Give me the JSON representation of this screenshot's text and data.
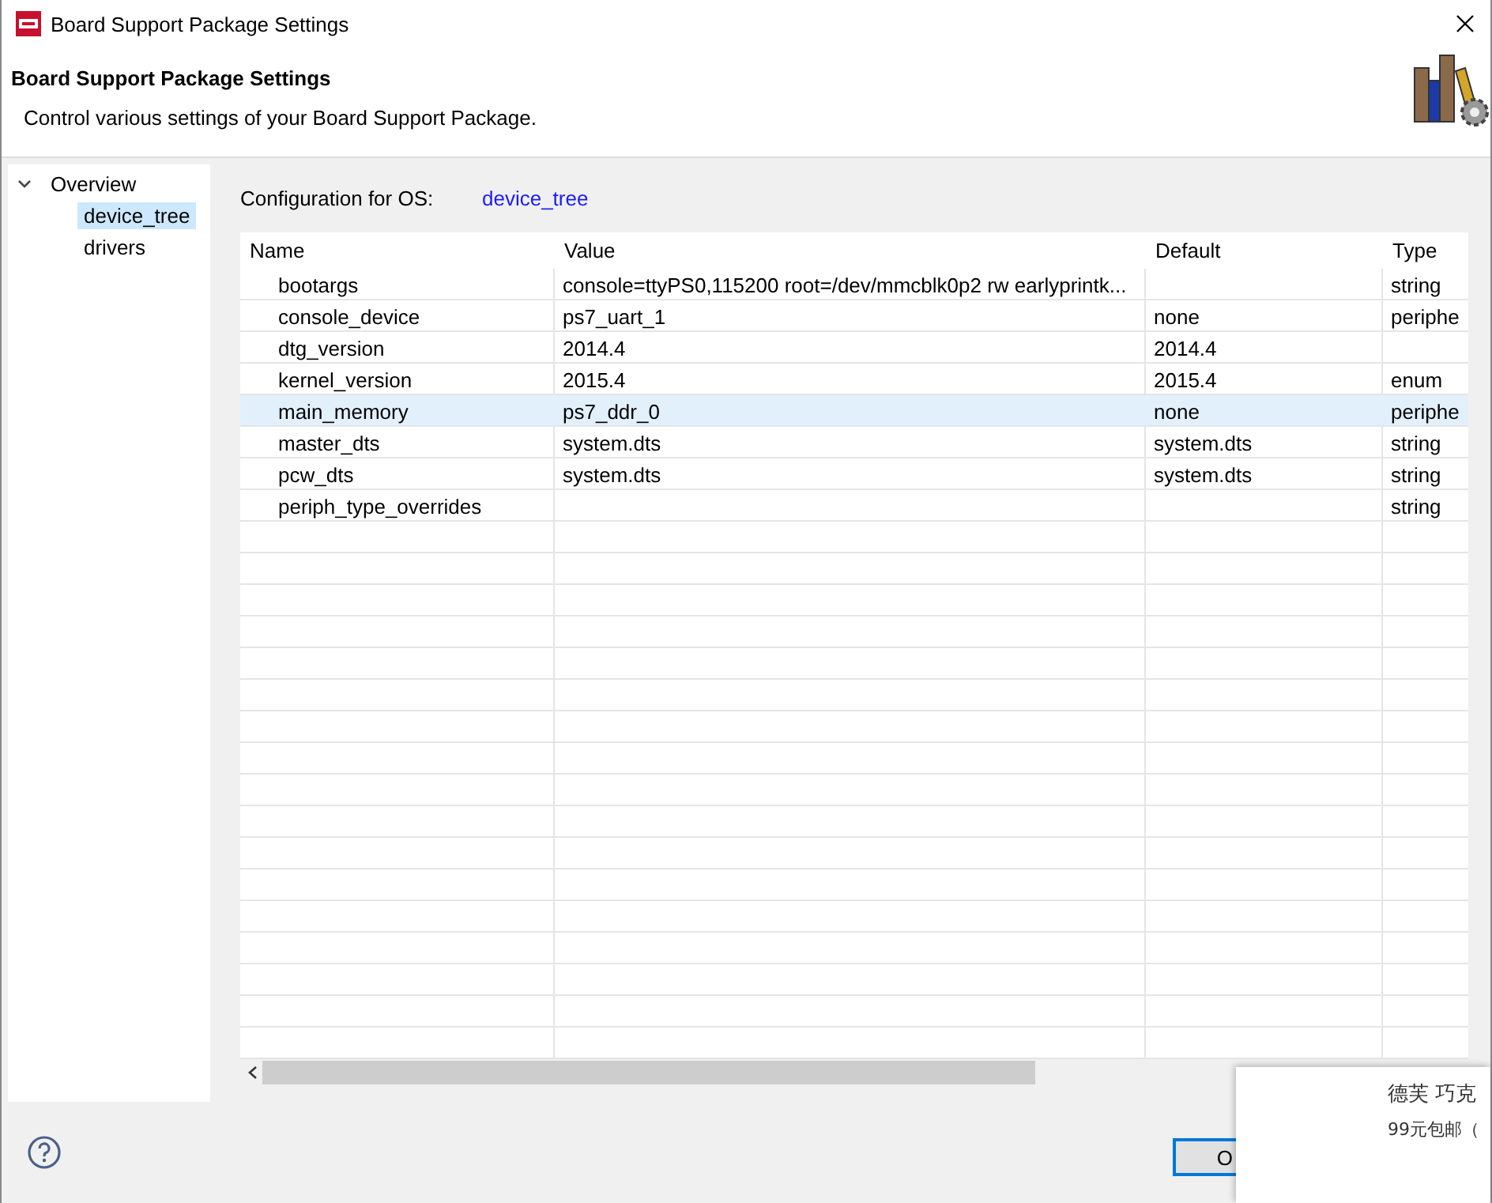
{
  "window": {
    "title": "Board Support Package Settings"
  },
  "header": {
    "title": "Board Support Package Settings",
    "description": "Control various settings of your Board Support Package."
  },
  "sidebar": {
    "items": [
      {
        "label": "Overview",
        "expanded": true,
        "selected": false,
        "children": [
          {
            "label": "device_tree",
            "selected": true
          },
          {
            "label": "drivers",
            "selected": false
          }
        ]
      }
    ]
  },
  "config": {
    "label": "Configuration for OS:",
    "link": "device_tree"
  },
  "table": {
    "columns": [
      "Name",
      "Value",
      "Default",
      "Type"
    ],
    "rows": [
      {
        "cells": [
          "bootargs",
          "console=ttyPS0,115200 root=/dev/mmcblk0p2 rw earlyprintk...",
          "",
          "string"
        ],
        "selected": false
      },
      {
        "cells": [
          "console_device",
          "ps7_uart_1",
          "none",
          "periphe"
        ],
        "selected": false
      },
      {
        "cells": [
          "dtg_version",
          "2014.4",
          "2014.4",
          ""
        ],
        "selected": false
      },
      {
        "cells": [
          "kernel_version",
          "2015.4",
          "2015.4",
          "enum"
        ],
        "selected": false
      },
      {
        "cells": [
          "main_memory",
          "ps7_ddr_0",
          "none",
          "periphe"
        ],
        "selected": true
      },
      {
        "cells": [
          "master_dts",
          "system.dts",
          "system.dts",
          "string"
        ],
        "selected": false
      },
      {
        "cells": [
          "pcw_dts",
          "system.dts",
          "system.dts",
          "string"
        ],
        "selected": false
      },
      {
        "cells": [
          "periph_type_overrides",
          "",
          "",
          "string"
        ],
        "selected": false
      }
    ]
  },
  "footer": {
    "button": "O"
  },
  "popup": {
    "lines": [
      "德芙 巧克",
      "99元包邮（"
    ]
  }
}
